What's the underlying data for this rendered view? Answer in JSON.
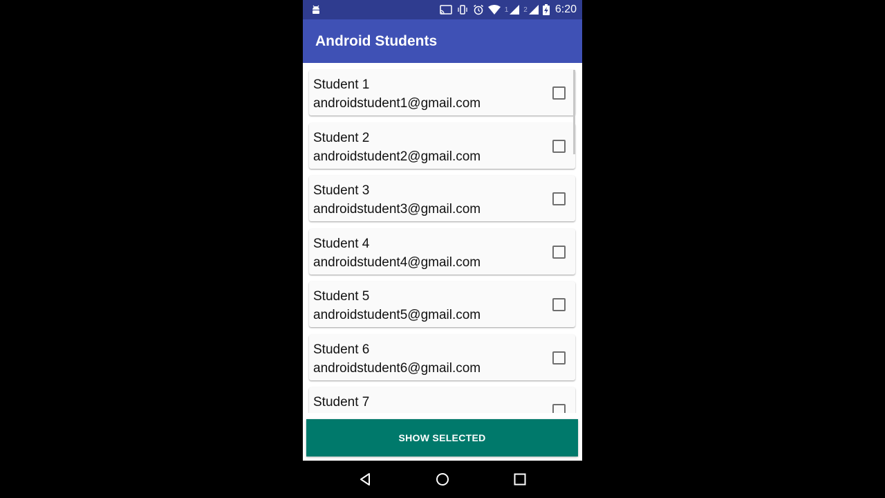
{
  "status_bar": {
    "time": "6:20",
    "sim1": "1",
    "sim2": "2",
    "battery_icon": "battery-charging-icon"
  },
  "app_bar": {
    "title": "Android Students"
  },
  "students": [
    {
      "name": "Student 1",
      "email": "androidstudent1@gmail.com",
      "checked": false
    },
    {
      "name": "Student 2",
      "email": "androidstudent2@gmail.com",
      "checked": false
    },
    {
      "name": "Student 3",
      "email": "androidstudent3@gmail.com",
      "checked": false
    },
    {
      "name": "Student 4",
      "email": "androidstudent4@gmail.com",
      "checked": false
    },
    {
      "name": "Student 5",
      "email": "androidstudent5@gmail.com",
      "checked": false
    },
    {
      "name": "Student 6",
      "email": "androidstudent6@gmail.com",
      "checked": false
    },
    {
      "name": "Student 7",
      "email": "",
      "checked": false
    }
  ],
  "actions": {
    "show_selected_label": "SHOW SELECTED"
  },
  "colors": {
    "status_bar": "#2f3c8f",
    "app_bar": "#3f51b5",
    "button": "#00796b"
  }
}
